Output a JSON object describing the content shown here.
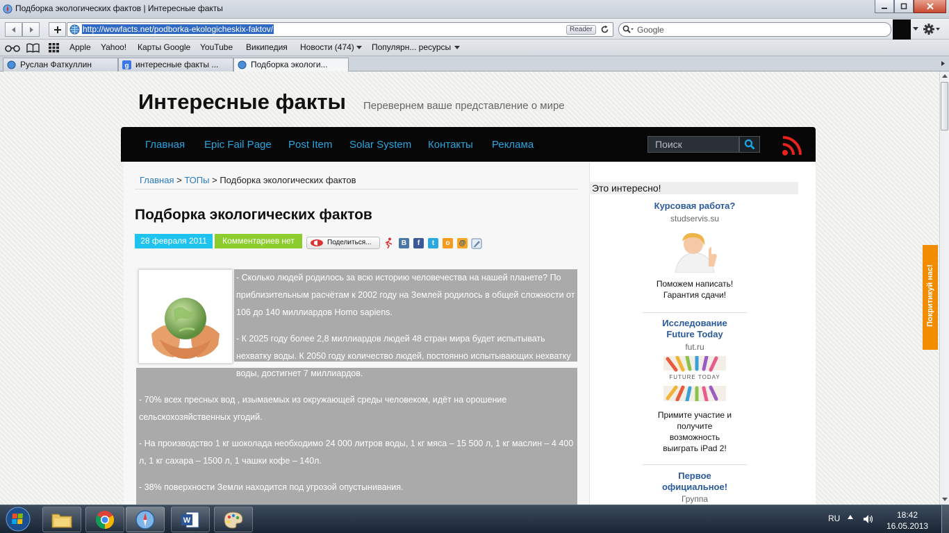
{
  "window": {
    "title": "Подборка экологических фактов | Интересные факты"
  },
  "toolbar": {
    "url": "http://wowfacts.net/podborka-ekologicheskix-faktov/",
    "reader_label": "Reader",
    "search_placeholder": "Google"
  },
  "bookmarks": {
    "items": [
      "Apple",
      "Yahoo!",
      "Карты Google",
      "YouTube",
      "Википедия",
      "Новости (474)",
      "Популярн... ресурсы"
    ]
  },
  "tabs": [
    {
      "label": "Руслан Фаткуллин"
    },
    {
      "label": "интересные факты ..."
    },
    {
      "label": "Подборка экологи..."
    }
  ],
  "site": {
    "title": "Интересные факты",
    "tagline": "Перевернем ваше представление о мире",
    "nav": [
      "Главная",
      "Epic Fail Page",
      "Post Item",
      "Solar System",
      "Контакты",
      "Реклама"
    ],
    "search_placeholder": "Поиск"
  },
  "post": {
    "breadcrumb": {
      "home": "Главная",
      "sep": ">",
      "section": "ТОПы",
      "current": "Подборка экологических фактов"
    },
    "title": "Подборка экологических фактов",
    "date": "28 февраля 2011",
    "comments": "Комментариев нет",
    "share_label": "Поделиться...",
    "paragraphs": [
      "- Сколько людей родилось за всю историю человечества на нашей планете? По приблизительным расчётам к 2002 году на Землей родилось в общей сложности от 106 до 140 миллиардов Homo sapiens.",
      "- К 2025 году более 2,8 миллиардов людей 48 стран мира будет испытывать нехватку воды. К 2050 году количество людей, постоянно испытывающих нехватку воды, достигнет 7 миллиардов.",
      "- 70% всех пресных вод , изымаемых из окружающей среды человеком, идёт на орошение сельскохозяйственных угодий.",
      "- На производство 1 кг шоколада необходимо 24 000 литров воды, 1 кг мяса – 15 500 л, 1 кг маслин – 4 400 л, 1 кг сахара – 1500 л, 1 чашки кофе – 140л.",
      "- 38% поверхности Земли находится под угрозой опустынивания."
    ]
  },
  "sidebar": {
    "heading": "Это интересно!",
    "ads": [
      {
        "title": "Курсовая работа?",
        "source": "studservis.su",
        "text": "Поможем написать! Гарантия сдачи!"
      },
      {
        "title": "Исследование Future Today",
        "source": "fut.ru",
        "image_caption": "FUTURE TODAY",
        "text": "Примите участие и получите возможность выиграть iPad 2!"
      },
      {
        "title": "Первое официальное!",
        "source": "Группа"
      }
    ]
  },
  "feedback_tab": {
    "label": "Покритикуй нас!"
  },
  "taskbar": {
    "lang": "RU",
    "time": "18:42",
    "date": "16.05.2013"
  },
  "colors": {
    "nav_link": "#29a6e0",
    "date_badge": "#1ec3f0",
    "comments_badge": "#8ccc2c",
    "feedback": "#f28c00",
    "rss": "#e8231d"
  }
}
